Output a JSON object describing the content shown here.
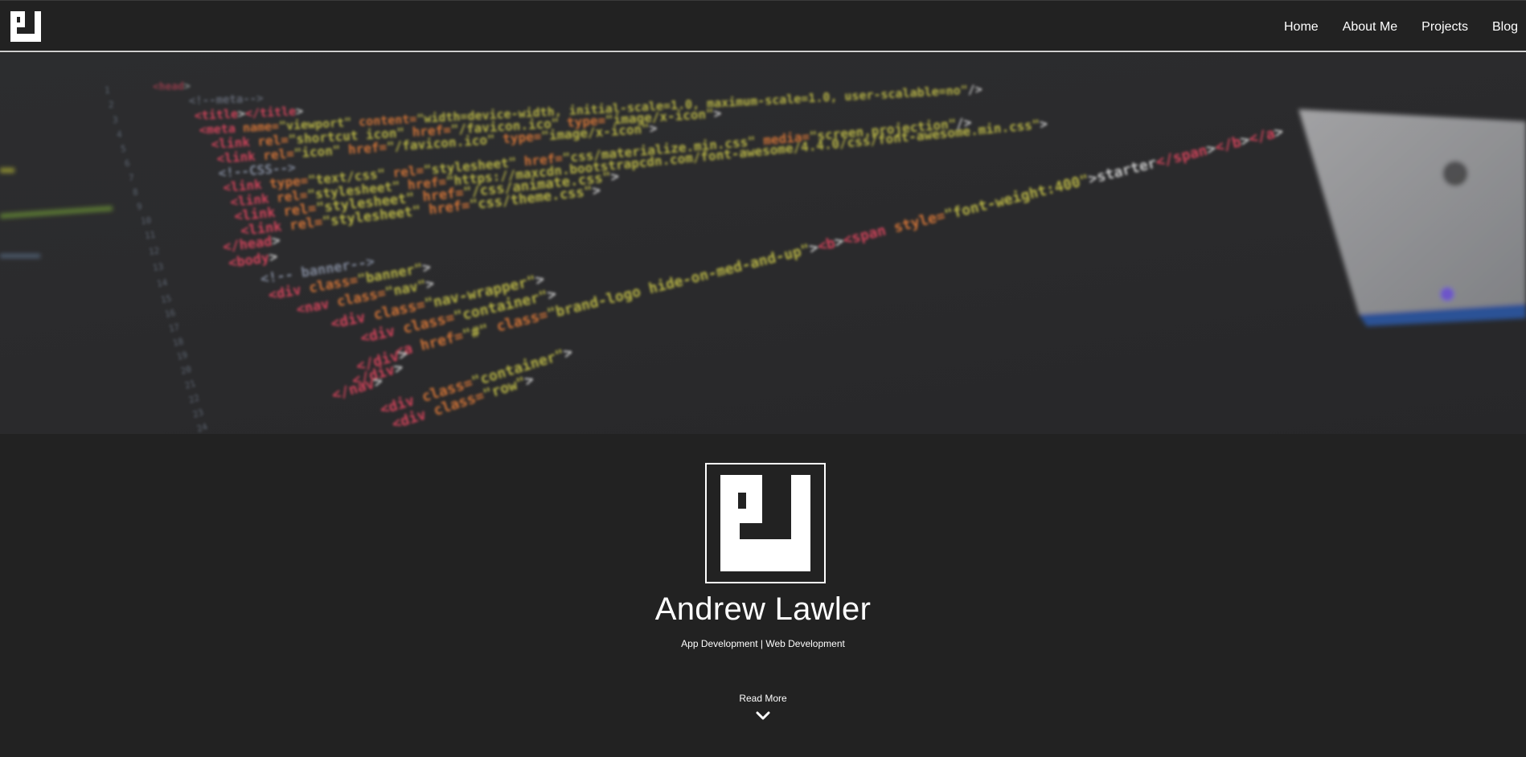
{
  "nav": {
    "logo_icon": "pl-monogram-logo-icon",
    "links": [
      "Home",
      "About Me",
      "Projects",
      "Blog"
    ]
  },
  "hero": {
    "background": "code-editor-photo",
    "code_lines": [
      "<head>",
      "<!--meta-->",
      "<title></title>",
      "<meta name=\"viewport\" content=\"width=device-width, initial-scale=1.0, maximum-scale=1.0, user-scalable=no\"/>",
      "<link rel=\"shortcut icon\" href=\"/favicon.ico\" type=\"image/x-icon\">",
      "<link rel=\"icon\" href=\"/favicon.ico\" type=\"image/x-icon\">",
      "<!--CSS-->",
      "<link type=\"text/css\" rel=\"stylesheet\" href=\"css/materialize.min.css\" media=\"screen,projection\"/>",
      "<link rel=\"stylesheet\" href=\"https://maxcdn.bootstrapcdn.com/font-awesome/4.4.0/css/font-awesome.min.css\">",
      "<link rel=\"stylesheet\" href=\"/css/animate.css\">",
      "<link rel=\"stylesheet\" href=\"css/theme.css\">",
      "</head>",
      "<body>",
      "<!-- banner-->",
      "<div class=\"banner\">",
      "<nav class=\"nav\">",
      "<div class=\"nav-wrapper\">",
      "<div class=\"container\">",
      "<a href=\"#\" class=\"brand-logo hide-on-med-and-up\"><b><span style=\"font-weight:400\">starter</span></b></a>",
      "</div>",
      "</div>",
      "</nav>",
      "<div class=\"container\">",
      "<div class=\"row\">"
    ]
  },
  "profile": {
    "avatar_icon": "pl-monogram-logo-icon",
    "name": "Andrew Lawler",
    "tagline": "App Development | Web Development",
    "read_more": "Read More",
    "scroll_icon": "chevron-down-icon"
  },
  "colors": {
    "background": "#222222",
    "text": "#ffffff",
    "nav_border": "#cfcfcf"
  }
}
